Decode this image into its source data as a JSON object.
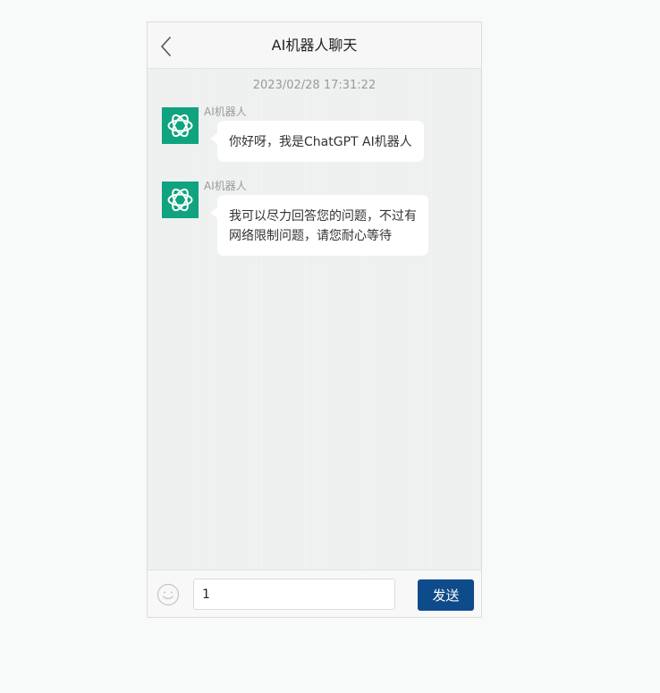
{
  "header": {
    "title": "AI机器人聊天",
    "back_icon": "chevron-left-icon"
  },
  "chat": {
    "timestamp": "2023/02/28 17:31:22",
    "messages": [
      {
        "sender": "AI机器人",
        "avatar_icon": "openai-logo-icon",
        "text": "你好呀，我是ChatGPT AI机器人"
      },
      {
        "sender": "AI机器人",
        "avatar_icon": "openai-logo-icon",
        "text_lines": [
          "我可以尽力回答您的问题，不过有",
          "网络限制问题，请您耐心等待"
        ]
      }
    ]
  },
  "footer": {
    "emoji_icon": "smiley-icon",
    "input_value": "1",
    "send_label": "发送"
  },
  "colors": {
    "accent": "#0e4b8a",
    "avatar_bg": "#10a37f",
    "page_bg": "#f8f9f9"
  }
}
